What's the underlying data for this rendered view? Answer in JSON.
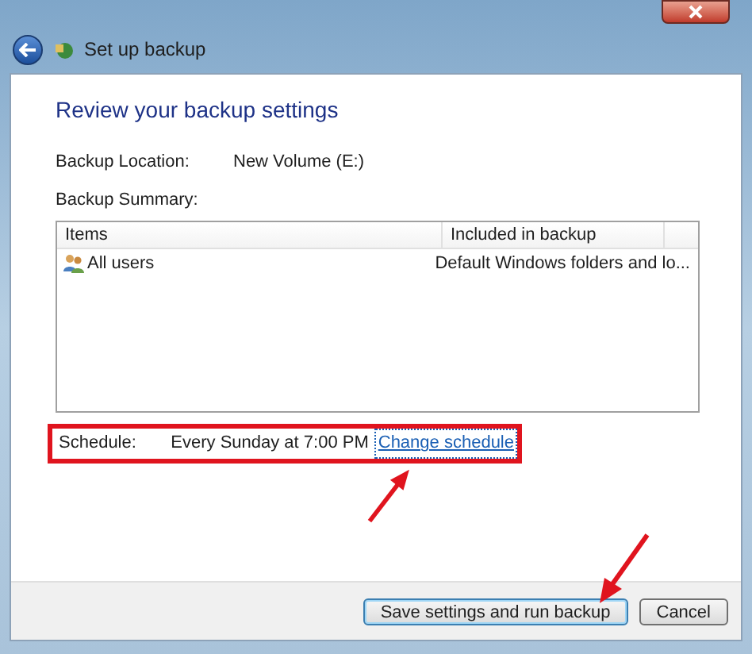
{
  "window": {
    "title": "Set up backup"
  },
  "heading": "Review your backup settings",
  "backup_location": {
    "label": "Backup Location:",
    "value": "New Volume (E:)"
  },
  "backup_summary": {
    "label": "Backup Summary:"
  },
  "table": {
    "columns": [
      "Items",
      "Included in backup"
    ],
    "rows": [
      {
        "item": "All users",
        "included": "Default Windows folders and lo..."
      }
    ]
  },
  "schedule": {
    "label": "Schedule:",
    "value": "Every Sunday at 7:00 PM",
    "link": "Change schedule"
  },
  "buttons": [
    {
      "label": "Save settings and run backup",
      "default": true
    },
    {
      "label": "Cancel",
      "default": false
    }
  ]
}
